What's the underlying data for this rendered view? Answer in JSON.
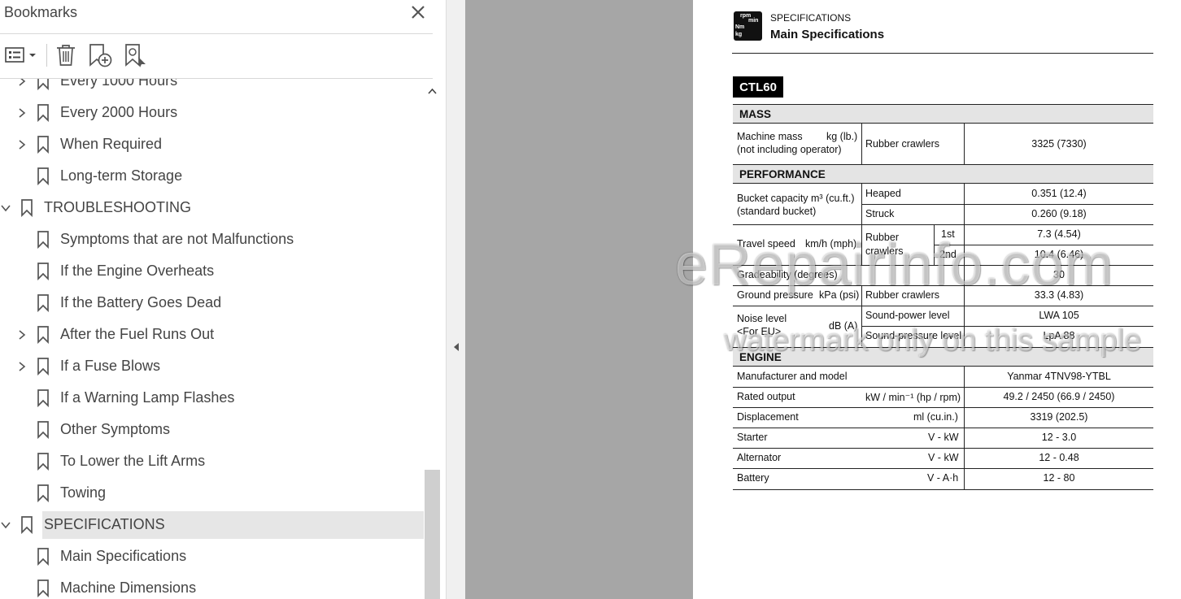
{
  "panel": {
    "title": "Bookmarks",
    "items": [
      {
        "label": "Every 1000 Hours",
        "level": 1,
        "expandable": true
      },
      {
        "label": "Every 2000 Hours",
        "level": 1,
        "expandable": true
      },
      {
        "label": "When Required",
        "level": 1,
        "expandable": true
      },
      {
        "label": "Long-term Storage",
        "level": 1,
        "expandable": false
      },
      {
        "label": "TROUBLESHOOTING",
        "level": 0,
        "expandable": true,
        "expanded": true
      },
      {
        "label": "Symptoms that are not Malfunctions",
        "level": 1,
        "expandable": false
      },
      {
        "label": "If the Engine Overheats",
        "level": 1,
        "expandable": false
      },
      {
        "label": "If the Battery Goes Dead",
        "level": 1,
        "expandable": false
      },
      {
        "label": "After the Fuel Runs Out",
        "level": 1,
        "expandable": true
      },
      {
        "label": "If a Fuse Blows",
        "level": 1,
        "expandable": true
      },
      {
        "label": "If a Warning Lamp Flashes",
        "level": 1,
        "expandable": false
      },
      {
        "label": "Other Symptoms",
        "level": 1,
        "expandable": false
      },
      {
        "label": "To Lower the Lift Arms",
        "level": 1,
        "expandable": false
      },
      {
        "label": "Towing",
        "level": 1,
        "expandable": false
      },
      {
        "label": "SPECIFICATIONS",
        "level": 0,
        "expandable": true,
        "expanded": true,
        "selected": true
      },
      {
        "label": "Main Specifications",
        "level": 1,
        "expandable": false
      },
      {
        "label": "Machine Dimensions",
        "level": 1,
        "expandable": false
      }
    ]
  },
  "doc": {
    "icon_text": {
      "a": "rpm",
      "b": "min",
      "c": "Nm",
      "d": "kg"
    },
    "section": "SPECIFICATIONS",
    "title": "Main Specifications",
    "model": "CTL60",
    "mass_header": "MASS",
    "machine_mass_1": "Machine mass",
    "machine_mass_unit": "kg (lb.)",
    "machine_mass_2": "(not including operator)",
    "rubber_crawlers": "Rubber crawlers",
    "machine_mass_value": "3325 (7330)",
    "performance_header": "PERFORMANCE",
    "bucket_1": "Bucket capacity  m³ (cu.ft.)",
    "bucket_2": "(standard bucket)",
    "heaped": "Heaped",
    "heaped_value": "0.351 (12.4)",
    "struck": "Struck",
    "struck_value": "0.260 (9.18)",
    "travel_speed": "Travel speed",
    "travel_unit": "km/h (mph)",
    "rubber_1": "Rubber",
    "rubber_2": "crawlers",
    "first": "1st",
    "first_value": "7.3 (4.54)",
    "second": "2nd",
    "second_value": "10.4 (6.46)",
    "gradeability": "Gradeability (degrees)",
    "gradeability_value": "30",
    "ground_pressure": "Ground pressure",
    "ground_unit": "kPa (psi)",
    "ground_value": "33.3 (4.83)",
    "noise_1": "Noise level",
    "noise_2": "<For EU>",
    "noise_unit": "dB (A)",
    "sound_power": "Sound-power level",
    "sound_power_value": "LWA 105",
    "sound_pressure": "Sound-pressure level",
    "sound_pressure_value": "LpA 88",
    "engine_header": "ENGINE",
    "manufacturer": "Manufacturer and model",
    "manufacturer_value": "Yanmar 4TNV98-YTBL",
    "rated_output": "Rated output",
    "rated_unit": "kW / min⁻¹ (hp / rpm)",
    "rated_value": "49.2 / 2450 (66.9 / 2450)",
    "displacement": "Displacement",
    "displacement_unit": "ml (cu.in.)",
    "displacement_value": "3319 (202.5)",
    "starter": "Starter",
    "starter_unit": "V - kW",
    "starter_value": "12 - 3.0",
    "alternator": "Alternator",
    "alternator_unit": "V - kW",
    "alternator_value": "12 - 0.48",
    "battery": "Battery",
    "battery_unit": "V - A·h",
    "battery_value": "12 - 80"
  },
  "watermark": {
    "line1": "eRepairinfo.com",
    "line2": "watermark only on this sample"
  }
}
